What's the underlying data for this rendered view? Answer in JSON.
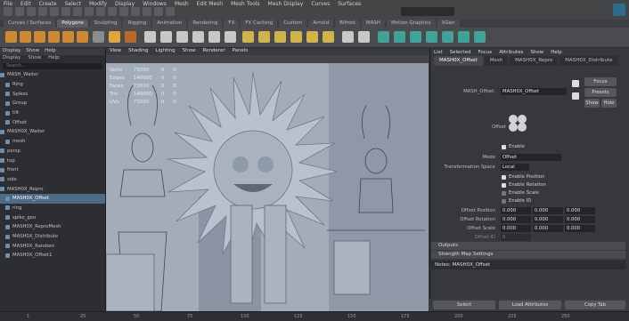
{
  "app": {
    "name": "Maya"
  },
  "top_menu": [
    "File",
    "Edit",
    "Create",
    "Select",
    "Modify",
    "Display",
    "Windows",
    "Mesh",
    "Edit Mesh",
    "Mesh Tools",
    "Mesh Display",
    "Curves",
    "Surfaces"
  ],
  "shelf_tabs": [
    "Curves / Surfaces",
    "Polygons",
    "Sculpting",
    "Rigging",
    "Animation",
    "Rendering",
    "FX",
    "FX Caching",
    "Custom",
    "Arnold",
    "Bifrost",
    "MASH",
    "Motion Graphics",
    "XGen"
  ],
  "shelf_active": "Polygons",
  "outliner": {
    "header": [
      "Display",
      "Show",
      "Help"
    ],
    "menu": [
      "Display",
      "Show",
      "Help"
    ],
    "search_placeholder": "Search...",
    "items": [
      "MASH_Waiter",
      "Ring",
      "Spikes",
      "Group",
      "tilt",
      "Offset",
      "MASH0X_Waiter",
      "mesh",
      "persp",
      "top",
      "front",
      "side",
      "MASH0X_Repro",
      "MASH0X_Offset",
      "ring",
      "spike_geo",
      "MASH0X_ReproMesh",
      "MASH0X_Distribute",
      "MASH0X_Random",
      "MASH0X_Offset1"
    ]
  },
  "viewport": {
    "menu": [
      "View",
      "Shading",
      "Lighting",
      "Show",
      "Renderer",
      "Panels"
    ],
    "hud": [
      {
        "label": "Verts",
        "a": "73000",
        "b": "0",
        "c": "0"
      },
      {
        "label": "Edges",
        "a": "146000",
        "b": "0",
        "c": "0"
      },
      {
        "label": "Faces",
        "a": "73000",
        "b": "0",
        "c": "0"
      },
      {
        "label": "Tris",
        "a": "146000",
        "b": "0",
        "c": "0"
      },
      {
        "label": "UVs",
        "a": "73000",
        "b": "0",
        "c": "0"
      }
    ]
  },
  "attribute_editor": {
    "menu": [
      "List",
      "Selected",
      "Focus",
      "Attributes",
      "Show",
      "Help"
    ],
    "tabs": [
      "MASH0X_Offset",
      "Mesh",
      "MASH0X_Repro",
      "MASH0X_Distribute"
    ],
    "node_label": "MASH_Offset:",
    "node_value": "MASH0X_Offset",
    "buttons": [
      "Focus",
      "Presets",
      "Show",
      "Hide"
    ],
    "icon_label": "Offset",
    "enable_label": "Enable",
    "enable_checked": true,
    "mode_label": "Mode",
    "mode_value": "Offset",
    "transform_space_label": "Transformation Space",
    "transform_space_value": "Local",
    "checkboxes": [
      {
        "label": "Enable Position",
        "checked": true
      },
      {
        "label": "Enable Rotation",
        "checked": true
      },
      {
        "label": "Enable Scale",
        "checked": false
      },
      {
        "label": "Enable ID",
        "checked": false
      }
    ],
    "offset_position": {
      "label": "Offset Position",
      "values": [
        "0.000",
        "0.000",
        "0.000"
      ]
    },
    "offset_rotation": {
      "label": "Offset Rotation",
      "values": [
        "0.000",
        "0.000",
        "0.000"
      ]
    },
    "offset_scale": {
      "label": "Offset Scale",
      "values": [
        "0.000",
        "0.000",
        "0.000"
      ]
    },
    "offset_id": {
      "label": "Offset ID",
      "value": "0"
    },
    "sections": [
      "Outputs",
      "Strength Map Settings"
    ],
    "notes_label": "Notes:",
    "notes_value": "MASH0X_Offset",
    "bottom_buttons": [
      "Select",
      "Load Attributes",
      "Copy Tab"
    ]
  },
  "timeline": {
    "ticks": [
      "1",
      "25",
      "50",
      "75",
      "100",
      "125",
      "150",
      "175",
      "200",
      "225",
      "250"
    ]
  },
  "colors": {
    "viewport_bg": "#a6b0bd",
    "accent": "#2d6d8c",
    "panel": "#37383b"
  }
}
